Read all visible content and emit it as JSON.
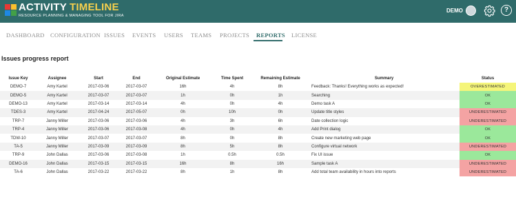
{
  "app": {
    "brand_part1": "ACTIVITY ",
    "brand_part2": "TIMELINE",
    "tagline": "RESOURCE PLANNING & MANAGING TOOL FOR JIRA",
    "user_label": "DEMO",
    "help_glyph": "?"
  },
  "nav": {
    "items": [
      {
        "label": "DASHBOARD",
        "active": false
      },
      {
        "label": "CONFIGURATION",
        "active": false
      },
      {
        "label": "ISSUES",
        "active": false
      },
      {
        "label": "EVENTS",
        "active": false
      },
      {
        "label": "USERS",
        "active": false
      },
      {
        "label": "TEAMS",
        "active": false
      },
      {
        "label": "PROJECTS",
        "active": false
      },
      {
        "label": "REPORTS",
        "active": true
      },
      {
        "label": "LICENSE",
        "active": false
      }
    ]
  },
  "report": {
    "title": "Issues progress report",
    "columns": [
      "Issue Key",
      "Assignee",
      "Start",
      "End",
      "Original Estimate",
      "Time Spent",
      "Remaining Estimate",
      "Summary",
      "Status"
    ],
    "rows": [
      {
        "key": "DEMO-7",
        "assignee": "Amy Kartel",
        "start": "2017-03-06",
        "end": "2017-03-07",
        "orig": "16h",
        "spent": "4h",
        "remaining": "8h",
        "summary": "Feedback: Thanks! Everything works as expected!",
        "status": "OVERESTIMATED",
        "status_type": "over"
      },
      {
        "key": "DEMO-5",
        "assignee": "Amy Kartel",
        "start": "2017-03-07",
        "end": "2017-03-07",
        "orig": "1h",
        "spent": "0h",
        "remaining": "1h",
        "summary": "Searching",
        "status": "OK",
        "status_type": "ok"
      },
      {
        "key": "DEMO-13",
        "assignee": "Amy Kartel",
        "start": "2017-03-14",
        "end": "2017-03-14",
        "orig": "4h",
        "spent": "0h",
        "remaining": "4h",
        "summary": "Demo task A",
        "status": "OK",
        "status_type": "ok"
      },
      {
        "key": "TDES-3",
        "assignee": "Amy Kartel",
        "start": "2017-04-24",
        "end": "2017-05-07",
        "orig": "0h",
        "spent": "10h",
        "remaining": "0h",
        "summary": "Update title styles",
        "status": "UNDERESTIMATED",
        "status_type": "under"
      },
      {
        "key": "TRP-7",
        "assignee": "Janny Miller",
        "start": "2017-03-06",
        "end": "2017-03-06",
        "orig": "4h",
        "spent": "3h",
        "remaining": "6h",
        "summary": "Date collection logic",
        "status": "UNDERESTIMATED",
        "status_type": "under"
      },
      {
        "key": "TRP-4",
        "assignee": "Janny Miller",
        "start": "2017-03-06",
        "end": "2017-03-08",
        "orig": "4h",
        "spent": "0h",
        "remaining": "4h",
        "summary": "Add Print dialog",
        "status": "OK",
        "status_type": "ok"
      },
      {
        "key": "TDW-10",
        "assignee": "Janny Miller",
        "start": "2017-03-07",
        "end": "2017-03-07",
        "orig": "8h",
        "spent": "0h",
        "remaining": "8h",
        "summary": "Create new marketing web page",
        "status": "OK",
        "status_type": "ok"
      },
      {
        "key": "TA-5",
        "assignee": "Janny Miller",
        "start": "2017-03-09",
        "end": "2017-03-09",
        "orig": "8h",
        "spent": "5h",
        "remaining": "8h",
        "summary": "Configure virtual network",
        "status": "UNDERESTIMATED",
        "status_type": "under"
      },
      {
        "key": "TRP-9",
        "assignee": "John Dallas",
        "start": "2017-03-06",
        "end": "2017-03-08",
        "orig": "1h",
        "spent": "0.5h",
        "remaining": "0.5h",
        "summary": "Fix UI issue",
        "status": "OK",
        "status_type": "ok"
      },
      {
        "key": "DEMO-16",
        "assignee": "John Dallas",
        "start": "2017-03-15",
        "end": "2017-03-15",
        "orig": "16h",
        "spent": "8h",
        "remaining": "16h",
        "summary": "Sample task A",
        "status": "UNDERESTIMATED",
        "status_type": "under"
      },
      {
        "key": "TA-6",
        "assignee": "John Dallas",
        "start": "2017-03-22",
        "end": "2017-03-22",
        "orig": "8h",
        "spent": "1h",
        "remaining": "8h",
        "summary": "Add total team availability in hours into reports",
        "status": "UNDERESTIMATED",
        "status_type": "under"
      }
    ]
  },
  "colors": {
    "header_bg": "#2f6b6a",
    "brand_accent": "#f6d04d",
    "status_ok": "#9be89b",
    "status_over": "#f5f57a",
    "status_under": "#f4a3a3",
    "row_alt": "#f2f2f2"
  },
  "icons": {
    "logo": "activity-timeline-logo-icon",
    "avatar": "user-avatar-icon",
    "settings": "gear-icon",
    "help": "help-icon"
  }
}
